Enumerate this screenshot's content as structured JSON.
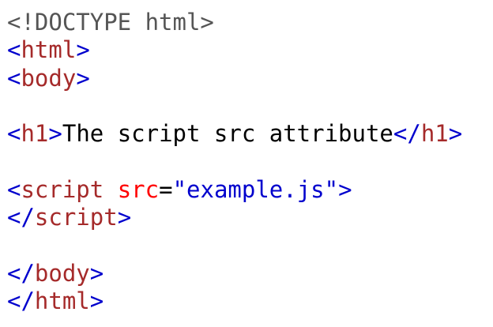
{
  "code": {
    "doctype": "<!DOCTYPE html>",
    "html_open": {
      "lt": "<",
      "name": "html",
      "gt": ">"
    },
    "body_open": {
      "lt": "<",
      "name": "body",
      "gt": ">"
    },
    "h1_open": {
      "lt": "<",
      "name": "h1",
      "gt": ">"
    },
    "h1_text": "The script src attribute",
    "h1_close": {
      "lt": "</",
      "name": "h1",
      "gt": ">"
    },
    "script_open": {
      "lt": "<",
      "name": "script",
      "attr": "src",
      "eq": "=",
      "value": "\"example.js\"",
      "gt": ">"
    },
    "script_close": {
      "lt": "</",
      "name": "script",
      "gt": ">"
    },
    "body_close": {
      "lt": "</",
      "name": "body",
      "gt": ">"
    },
    "html_close": {
      "lt": "</",
      "name": "html",
      "gt": ">"
    }
  },
  "colors": {
    "doctype": "#555555",
    "bracket": "#0000cd",
    "tag_name": "#a52a2a",
    "attribute": "#ff0000",
    "attribute_value": "#0000cd",
    "text": "#000000"
  }
}
